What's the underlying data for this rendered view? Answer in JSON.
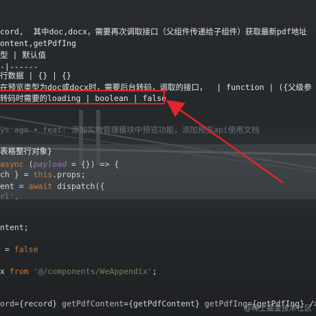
{
  "lines": {
    "l1": "cord,  其中doc,docx，需要再次调取接口（父组件传递给子组件）获取最新pdf地址",
    "l2": "ontent,getPdfIng",
    "l3": "型 | 默认值",
    "l4": "-|------",
    "l5": "行数据 | {} | {}",
    "l6": "在预览类型为doc或docx时，需要后台转码，调取的接口，  | function | ({父级参",
    "l7": "转码时需要的loading | boolean | false",
    "blame": "ys ago • feat: 添加实物管理模块中预览功能，添加预览api使用文档",
    "l9a": "表格整行对象}",
    "l10a": "async",
    "l10b": " (",
    "l10c": "payload",
    "l10d": " = {}) => {",
    "l11a": "ch } = ",
    "l11b": "this",
    "l11c": ".props;",
    "l12a": "ent = ",
    "l12b": "await",
    "l12c": " dispatch({",
    "l13a": "rl",
    "l13b": "',",
    "l15": "ntent;",
    "l17a": " = ",
    "l17b": "false",
    "l19a": "x ",
    "l19b": "from",
    "l19c": " '@/components/WeAppendix'",
    "l19d": ";",
    "l21a": "ord",
    "l21b": "={record} ",
    "l21c": "getPdfContent",
    "l21d": "={getPdfContent} ",
    "l21e": "getPdfIng",
    "l21f": "={getPdfIng} />"
  },
  "watermark": "@稀土掘金技术社区",
  "colors": {
    "highlight_box": "#e3242b",
    "arrow": "#e3242b"
  }
}
